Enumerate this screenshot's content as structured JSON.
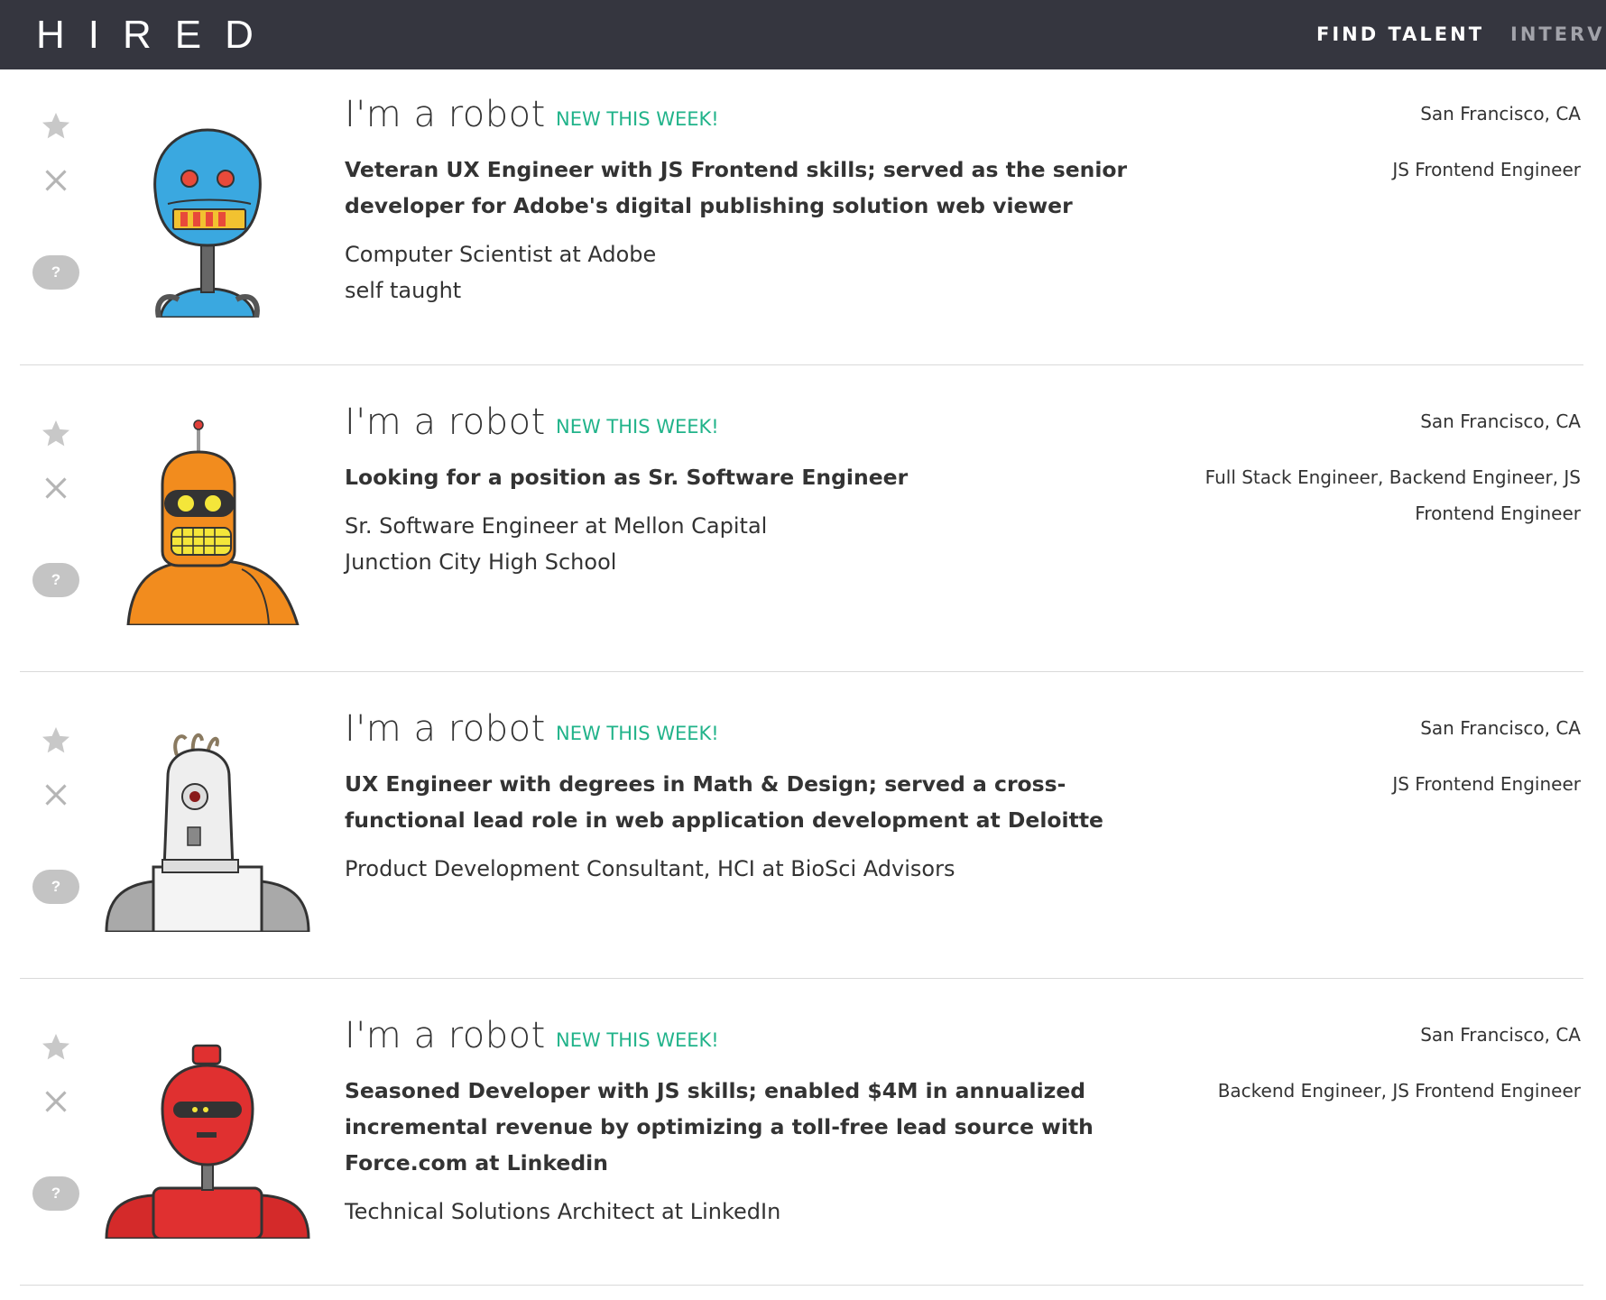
{
  "header": {
    "logo": "HIRED",
    "nav": [
      "FIND TALENT",
      "INTERVI"
    ]
  },
  "candidates": [
    {
      "name": "I'm a robot",
      "badge": "NEW THIS WEEK!",
      "headline": "Veteran UX Engineer with JS Frontend skills; served as the senior developer for Adobe's digital publishing solution web viewer",
      "detail1": "Computer Scientist at Adobe",
      "detail2": "self taught",
      "location": "San Francisco, CA",
      "roles": "JS Frontend Engineer",
      "avatar": "blue-robot"
    },
    {
      "name": "I'm a robot",
      "badge": "NEW THIS WEEK!",
      "headline": "Looking for a position as Sr. Software Engineer",
      "detail1": "Sr. Software Engineer at Mellon Capital",
      "detail2": "Junction City High School",
      "location": "San Francisco, CA",
      "roles": "Full Stack Engineer, Backend Engineer, JS Frontend Engineer",
      "avatar": "orange-robot"
    },
    {
      "name": "I'm a robot",
      "badge": "NEW THIS WEEK!",
      "headline": "UX Engineer with degrees in Math & Design; served a cross-functional lead role in web application development at Deloitte",
      "detail1": "Product Development Consultant, HCI at BioSci Advisors",
      "location": "San Francisco, CA",
      "roles": "JS Frontend Engineer",
      "avatar": "white-robot"
    },
    {
      "name": "I'm a robot",
      "badge": "NEW THIS WEEK!",
      "headline": "Seasoned Developer with JS skills; enabled $4M in annualized incremental revenue by optimizing a toll-free lead source with Force.com at Linkedin",
      "detail1": "Technical Solutions Architect at LinkedIn",
      "location": "San Francisco, CA",
      "roles": "Backend Engineer, JS Frontend Engineer",
      "avatar": "red-robot"
    }
  ],
  "icons": {
    "star": "star-icon",
    "dismiss": "close-icon",
    "question": "?"
  }
}
